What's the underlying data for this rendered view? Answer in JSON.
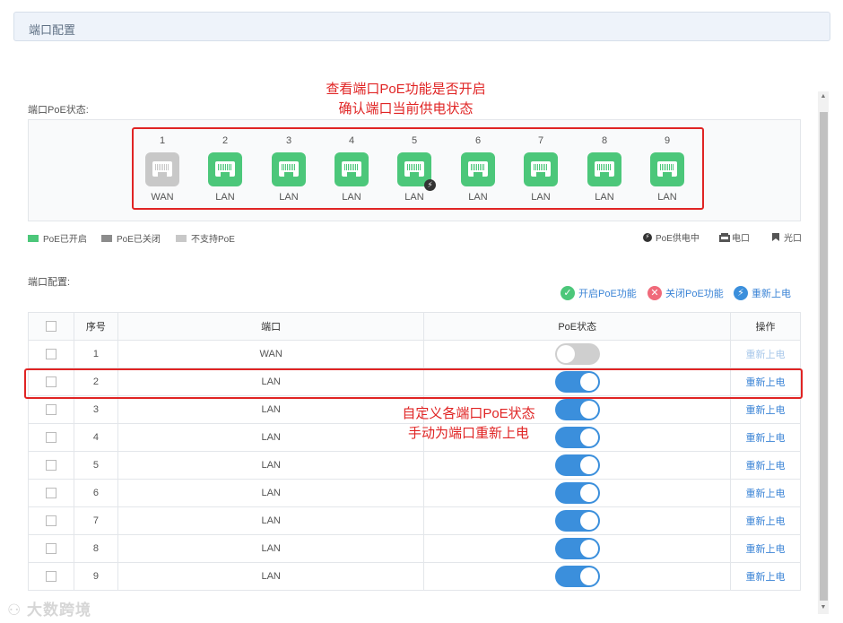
{
  "header": {
    "title": "端口配置"
  },
  "annotations": {
    "top_line1": "查看端口PoE功能是否开启",
    "top_line2": "确认端口当前供电状态",
    "mid_line1": "自定义各端口PoE状态",
    "mid_line2": "手动为端口重新上电"
  },
  "poe_status_label": "端口PoE状态:",
  "ports": [
    {
      "num": "1",
      "type": "WAN",
      "state": "unsupported"
    },
    {
      "num": "2",
      "type": "LAN",
      "state": "on"
    },
    {
      "num": "3",
      "type": "LAN",
      "state": "on"
    },
    {
      "num": "4",
      "type": "LAN",
      "state": "on"
    },
    {
      "num": "5",
      "type": "LAN",
      "state": "on",
      "powering": true
    },
    {
      "num": "6",
      "type": "LAN",
      "state": "on"
    },
    {
      "num": "7",
      "type": "LAN",
      "state": "on"
    },
    {
      "num": "8",
      "type": "LAN",
      "state": "on"
    },
    {
      "num": "9",
      "type": "LAN",
      "state": "on"
    }
  ],
  "legend": {
    "on": "PoE已开启",
    "off": "PoE已关闭",
    "unsupported": "不支持PoE",
    "powering": "PoE供电中",
    "electric": "电口",
    "optical": "光口",
    "colors": {
      "on": "#4cc77a",
      "off": "#8c8c8c",
      "unsupported": "#c8c8c8"
    }
  },
  "config_label": "端口配置:",
  "actions": {
    "enable": "开启PoE功能",
    "disable": "关闭PoE功能",
    "repower": "重新上电"
  },
  "table": {
    "headers": {
      "seq": "序号",
      "port": "端口",
      "poe": "PoE状态",
      "op": "操作"
    },
    "rows": [
      {
        "seq": "1",
        "port": "WAN",
        "poe_on": false,
        "op": "重新上电",
        "op_enabled": false
      },
      {
        "seq": "2",
        "port": "LAN",
        "poe_on": true,
        "op": "重新上电",
        "op_enabled": true
      },
      {
        "seq": "3",
        "port": "LAN",
        "poe_on": true,
        "op": "重新上电",
        "op_enabled": true
      },
      {
        "seq": "4",
        "port": "LAN",
        "poe_on": true,
        "op": "重新上电",
        "op_enabled": true
      },
      {
        "seq": "5",
        "port": "LAN",
        "poe_on": true,
        "op": "重新上电",
        "op_enabled": true
      },
      {
        "seq": "6",
        "port": "LAN",
        "poe_on": true,
        "op": "重新上电",
        "op_enabled": true
      },
      {
        "seq": "7",
        "port": "LAN",
        "poe_on": true,
        "op": "重新上电",
        "op_enabled": true
      },
      {
        "seq": "8",
        "port": "LAN",
        "poe_on": true,
        "op": "重新上电",
        "op_enabled": true
      },
      {
        "seq": "9",
        "port": "LAN",
        "poe_on": true,
        "op": "重新上电",
        "op_enabled": true
      }
    ]
  },
  "watermark": "大数跨境"
}
